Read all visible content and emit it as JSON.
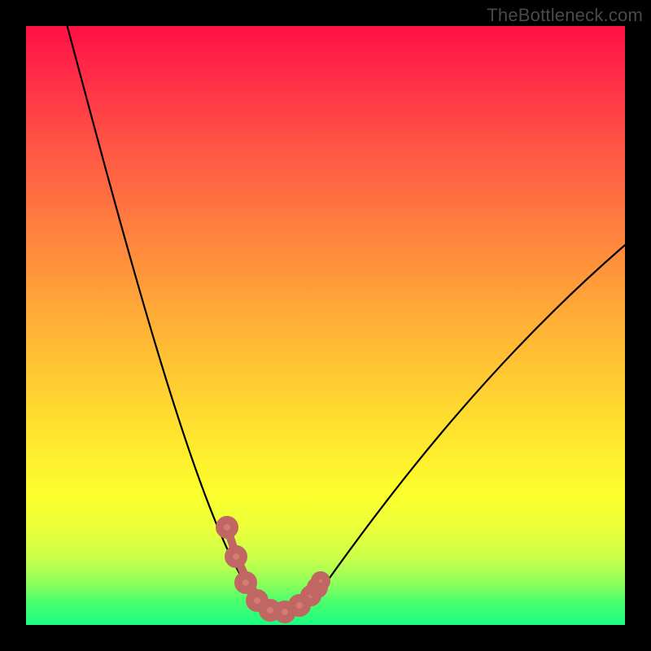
{
  "watermark": "TheBottleneck.com",
  "colors": {
    "frame": "#000000",
    "curve": "#000000",
    "marker_fill": "#d57a75",
    "marker_stroke": "#c06763"
  },
  "chart_data": {
    "type": "line",
    "title": "",
    "xlabel": "",
    "ylabel": "",
    "xlim": [
      0,
      100
    ],
    "ylim": [
      0,
      100
    ],
    "series": [
      {
        "name": "bottleneck-curve",
        "x": [
          6,
          10,
          14,
          18,
          22,
          26,
          30,
          33,
          36,
          38,
          40,
          42,
          44,
          48,
          52,
          56,
          60,
          65,
          70,
          75,
          80,
          85,
          90,
          95,
          100
        ],
        "y": [
          100,
          88,
          76,
          64,
          53,
          42,
          31,
          22,
          14,
          9,
          5,
          3,
          2,
          3,
          6,
          10,
          15,
          22,
          29,
          36,
          43,
          49,
          55,
          60,
          64
        ]
      }
    ],
    "markers": {
      "name": "highlighted-points",
      "style": "bead-chain",
      "x": [
        33.5,
        36,
        38,
        40,
        42,
        44,
        46,
        47.5,
        49
      ],
      "y": [
        17,
        10,
        5.5,
        3,
        2,
        2,
        3.5,
        6,
        10
      ]
    }
  }
}
